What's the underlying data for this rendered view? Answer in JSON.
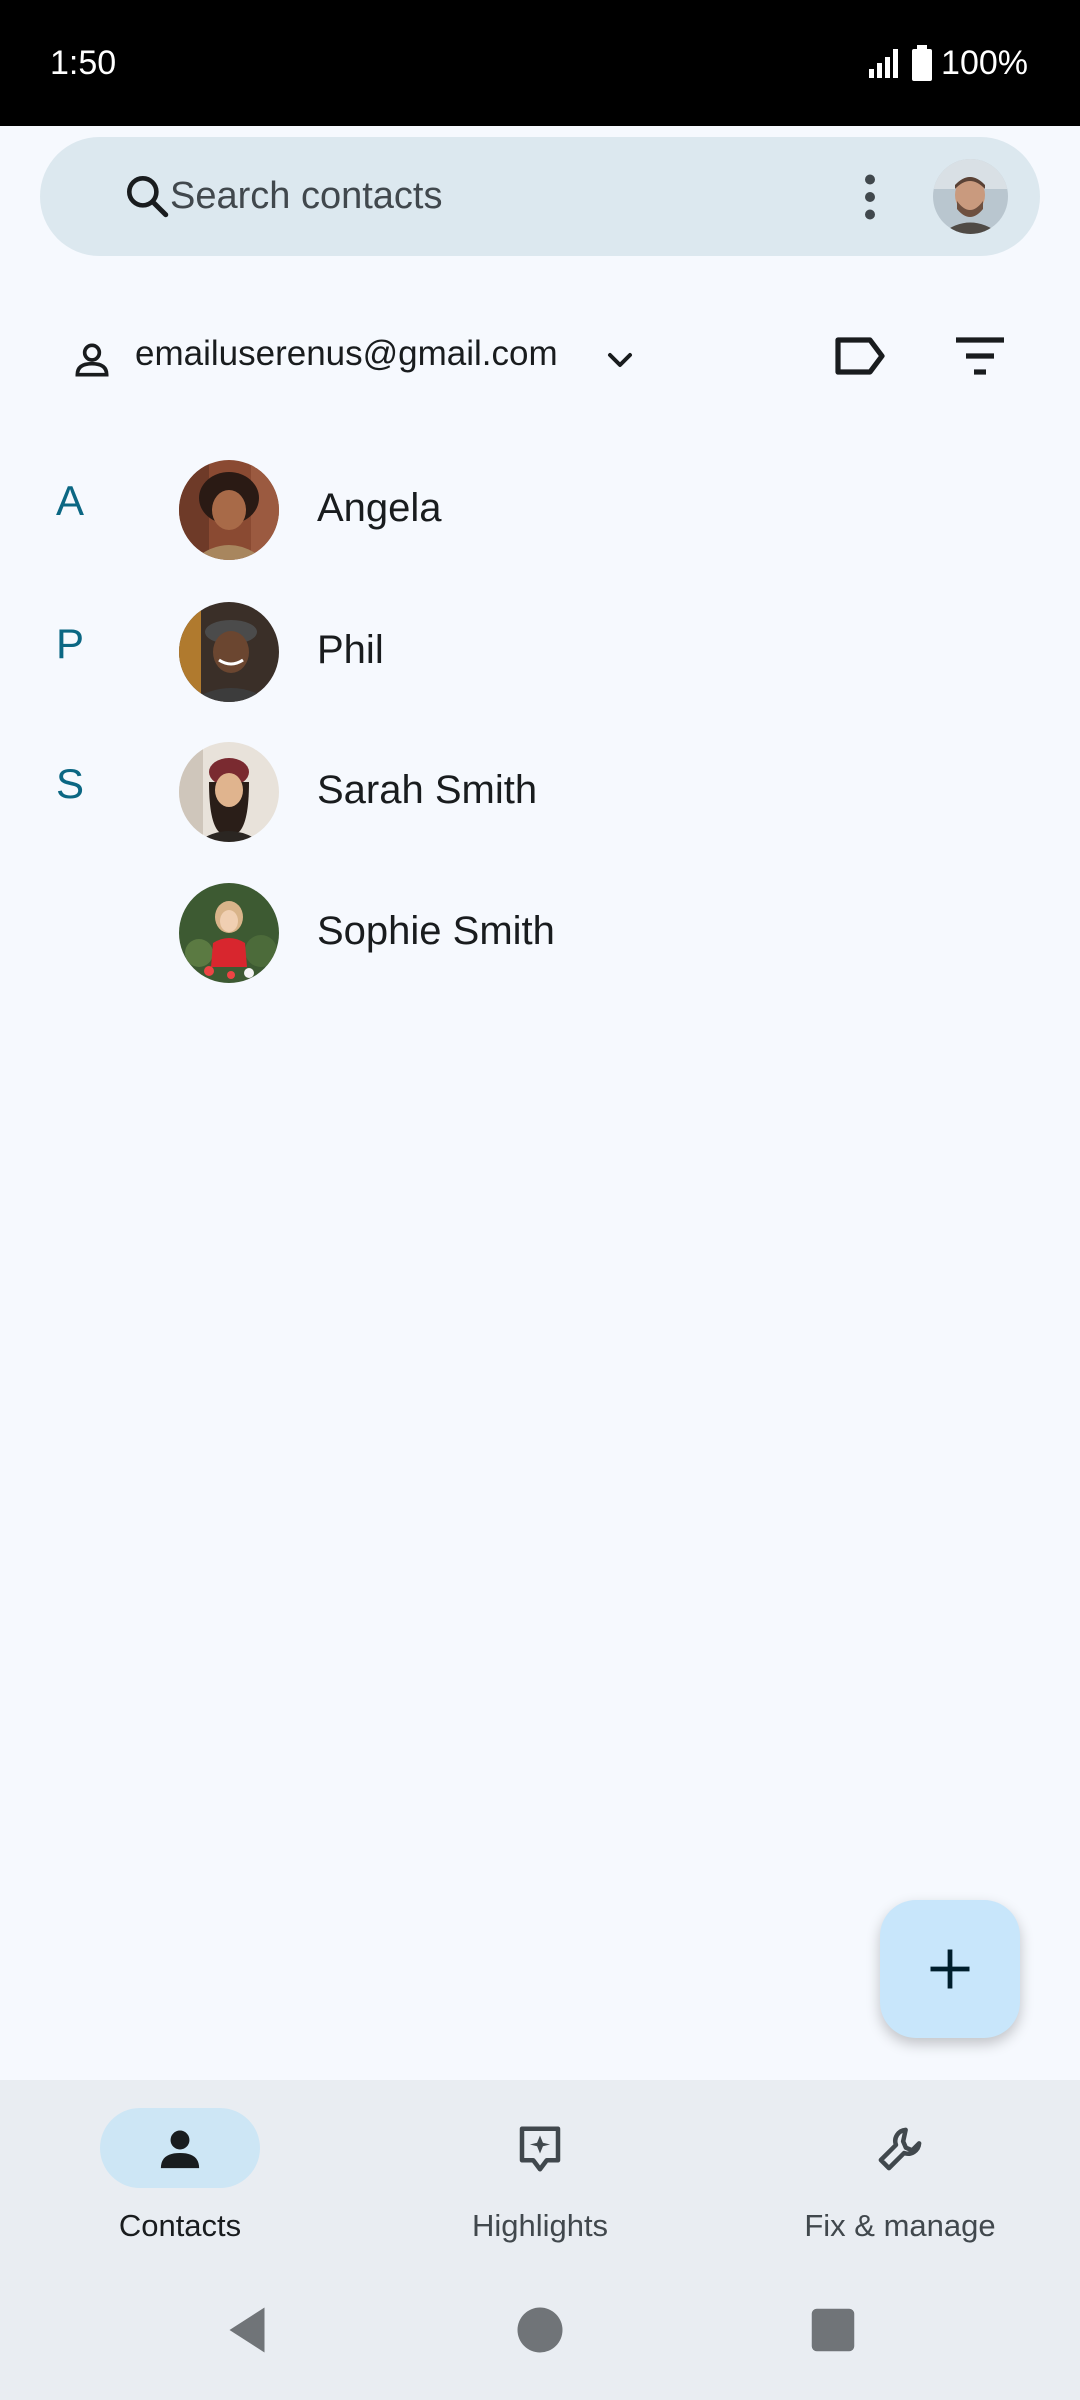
{
  "status_bar": {
    "time": "1:50",
    "battery": "100%"
  },
  "search": {
    "placeholder": "Search contacts"
  },
  "account": {
    "email": "emailuserenus@gmail.com"
  },
  "sections": [
    {
      "letter": "A"
    },
    {
      "letter": "P"
    },
    {
      "letter": "S"
    }
  ],
  "contacts": [
    {
      "name": "Angela"
    },
    {
      "name": "Phil"
    },
    {
      "name": "Sarah Smith"
    },
    {
      "name": "Sophie Smith"
    }
  ],
  "bottom_nav": {
    "contacts": "Contacts",
    "highlights": "Highlights",
    "fix_manage": "Fix & manage"
  },
  "colors": {
    "accent": "#0b6783",
    "background": "#f6f9fe",
    "search_bg": "#dce8ef",
    "fab_bg": "#c8e6fb",
    "nav_bg": "#e9edf2"
  },
  "icons": [
    "search-icon",
    "more-vert-icon",
    "person-icon",
    "chevron-down-icon",
    "label-icon",
    "filter-icon",
    "add-icon",
    "contacts-person-icon",
    "highlights-sparkle-icon",
    "wrench-icon",
    "back-icon",
    "home-icon",
    "recents-icon",
    "signal-icon",
    "battery-icon"
  ]
}
